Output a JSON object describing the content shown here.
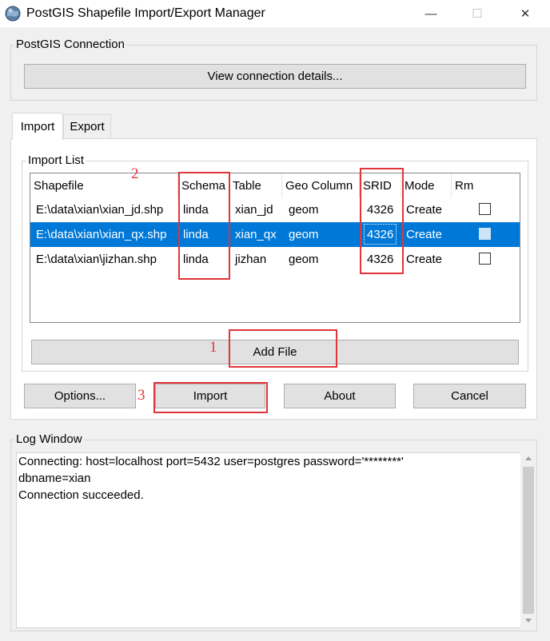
{
  "window": {
    "title": "PostGIS Shapefile Import/Export Manager",
    "minimize_glyph": "—",
    "maximize_glyph": "☐",
    "close_glyph": "✕"
  },
  "connection": {
    "group_label": "PostGIS Connection",
    "details_button": "View connection details..."
  },
  "tabs": [
    {
      "label": "Import",
      "active": true
    },
    {
      "label": "Export",
      "active": false
    }
  ],
  "import_list": {
    "group_label": "Import List",
    "columns": [
      "Shapefile",
      "Schema",
      "Table",
      "Geo Column",
      "SRID",
      "Mode",
      "Rm"
    ],
    "rows": [
      {
        "shapefile": "E:\\data\\xian\\xian_jd.shp",
        "schema": "linda",
        "table": "xian_jd",
        "geo_column": "geom",
        "srid": "4326",
        "mode": "Create",
        "rm": false,
        "selected": false
      },
      {
        "shapefile": "E:\\data\\xian\\xian_qx.shp",
        "schema": "linda",
        "table": "xian_qx",
        "geo_column": "geom",
        "srid": "4326",
        "mode": "Create",
        "rm": false,
        "selected": true
      },
      {
        "shapefile": "E:\\data\\xian\\jizhan.shp",
        "schema": "linda",
        "table": "jizhan",
        "geo_column": "geom",
        "srid": "4326",
        "mode": "Create",
        "rm": false,
        "selected": false
      }
    ],
    "add_file_button": "Add File"
  },
  "buttons": {
    "options": "Options...",
    "import": "Import",
    "about": "About",
    "cancel": "Cancel"
  },
  "annotations": {
    "n1": "1",
    "n2": "2",
    "n3": "3"
  },
  "log": {
    "group_label": "Log Window",
    "lines": [
      "Connecting:  host=localhost port=5432 user=postgres password='********'",
      "dbname=xian",
      "Connection succeeded."
    ]
  },
  "colors": {
    "selection": "#0078d7",
    "annotation_red": "#e0353b"
  }
}
